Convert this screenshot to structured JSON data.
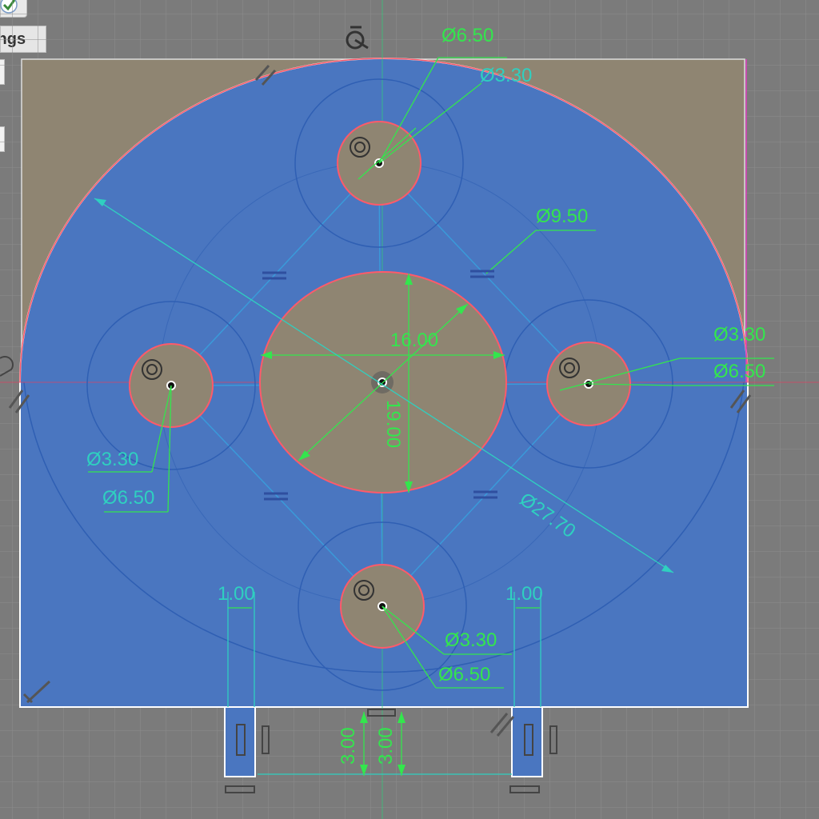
{
  "browser_panel": {
    "settings_label": "ings"
  },
  "dimensions": {
    "top_outer_dia": "Ø6.50",
    "top_inner_dia": "Ø3.30",
    "bolt_circle_dia": "Ø9.50",
    "center_hole_dia": "16.00",
    "center_hole_vertical": "19.00",
    "right_inner_dia": "Ø3.30",
    "right_outer_dia": "Ø6.50",
    "left_inner_dia": "Ø3.30",
    "left_outer_dia": "Ø6.50",
    "outer_arc_dia": "Ø27.70",
    "bottom_inner_dia": "Ø3.30",
    "bottom_outer_dia": "Ø6.50",
    "left_tab_width": "1.00",
    "right_tab_width": "1.00",
    "tab_height_a": "3.00",
    "tab_height_b": "3.00"
  },
  "colors": {
    "background": "#7b7b7b",
    "grid": "#8a8a8a",
    "profile_fill": "#4a76c0",
    "hole_fill": "#8f8572",
    "dimension": "#33e64d",
    "constraint_line": "#3a9ad9",
    "edge_highlight": "#ff5a6a",
    "axis_magenta": "#e040c0"
  },
  "icons": {
    "fix_icon": "fix-constraint-icon",
    "concentric_icon": "concentric-constraint-icon",
    "equal_icon": "equal-constraint-icon",
    "parallel_icon": "parallel-constraint-icon",
    "horizontal_icon": "horizontal-constraint-icon",
    "vertical_icon": "vertical-constraint-icon",
    "tangent_icon": "tangent-constraint-icon",
    "perpendicular_icon": "perpendicular-constraint-icon"
  }
}
